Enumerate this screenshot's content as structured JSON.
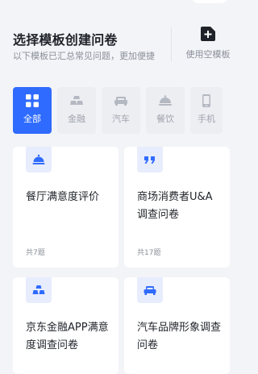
{
  "header": {
    "title": "选择模板创建问卷",
    "subtitle": "以下模板已汇总常见问题，更加便捷",
    "blank_label": "使用空模板"
  },
  "categories": [
    {
      "label": "全部",
      "icon": "grid-icon",
      "active": true
    },
    {
      "label": "金融",
      "icon": "gold-bars-icon",
      "active": false
    },
    {
      "label": "汽车",
      "icon": "car-icon",
      "active": false
    },
    {
      "label": "餐饮",
      "icon": "food-cloche-icon",
      "active": false
    },
    {
      "label": "手机",
      "icon": "phone-icon",
      "active": false
    }
  ],
  "templates": [
    {
      "title": "餐厅满意度评价",
      "count": "共7题",
      "icon": "food-cloche-icon"
    },
    {
      "title": "商场消费者U&A调查问卷",
      "count": "共17题",
      "icon": "quote-icon"
    },
    {
      "title": "京东金融APP满意度调查问卷",
      "count": "",
      "icon": "gold-bars-icon"
    },
    {
      "title": "汽车品牌形象调查问卷",
      "count": "",
      "icon": "sofa-icon"
    }
  ],
  "colors": {
    "accent": "#2f6bff",
    "badge_bg": "#e8edfd",
    "muted": "#8a8f99"
  }
}
